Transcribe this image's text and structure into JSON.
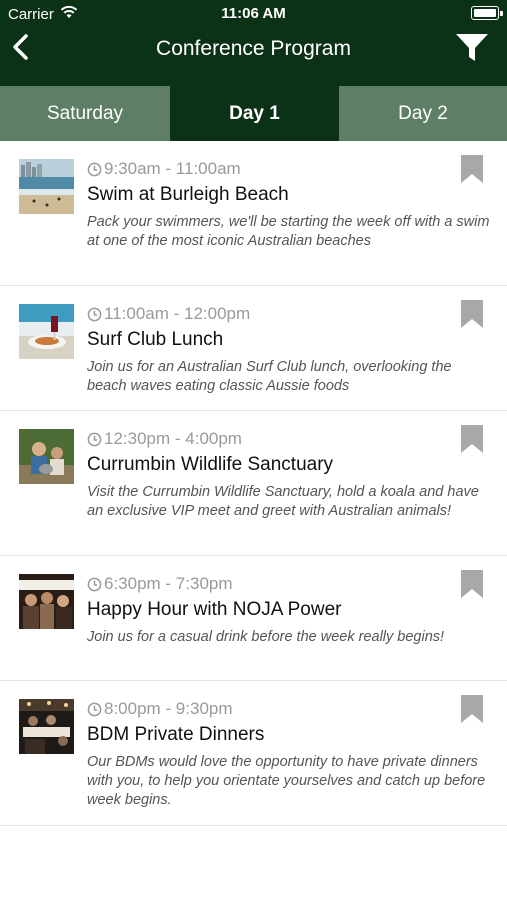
{
  "status": {
    "carrier": "Carrier",
    "time": "11:06 AM"
  },
  "header": {
    "title": "Conference Program"
  },
  "tabs": [
    {
      "label": "Saturday",
      "active": false
    },
    {
      "label": "Day 1",
      "active": true
    },
    {
      "label": "Day 2",
      "active": false
    }
  ],
  "events": [
    {
      "time": "9:30am - 11:00am",
      "title": "Swim at Burleigh Beach",
      "description": "Pack your swimmers, we'll be starting the week off with a swim at one of the most iconic Australian beaches"
    },
    {
      "time": "11:00am - 12:00pm",
      "title": "Surf Club Lunch",
      "description": "Join us for an Australian Surf Club lunch, overlooking the beach waves eating classic Aussie foods"
    },
    {
      "time": "12:30pm - 4:00pm",
      "title": "Currumbin Wildlife Sanctuary",
      "description": "Visit the Currumbin Wildlife Sanctuary, hold a koala and have an exclusive VIP meet and greet with Australian animals!"
    },
    {
      "time": "6:30pm - 7:30pm",
      "title": "Happy Hour with NOJA Power",
      "description": "Join us for a casual drink before the week really begins!"
    },
    {
      "time": "8:00pm - 9:30pm",
      "title": "BDM Private Dinners",
      "description": "Our BDMs would love the opportunity to have private dinners with you, to help you orientate yourselves and catch up before week begins."
    }
  ],
  "colors": {
    "header_bg": "#0b3216",
    "tab_inactive_bg": "#5e7e65",
    "tab_active_bg": "#0b3216",
    "time_text": "#9a9a9a",
    "bookmark": "#a8a8a8"
  },
  "icons": {
    "back": "chevron-left-icon",
    "filter": "funnel-icon",
    "time": "clock-icon",
    "save": "bookmark-icon"
  }
}
